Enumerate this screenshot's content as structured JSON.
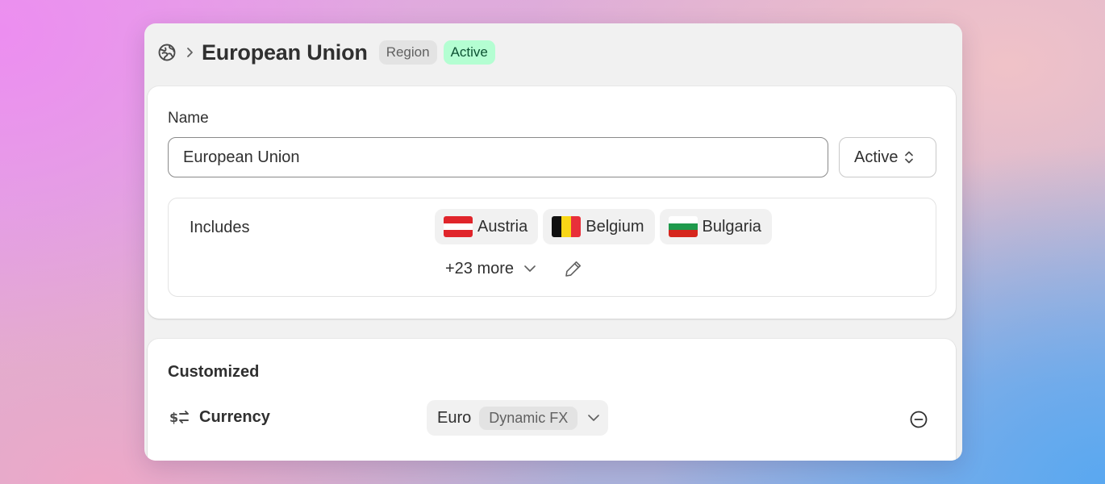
{
  "header": {
    "icon": "globe-icon",
    "title": "European Union",
    "type_badge": "Region",
    "status_badge": "Active"
  },
  "details": {
    "name_label": "Name",
    "name_value": "European Union",
    "status_value": "Active",
    "includes_label": "Includes",
    "countries": [
      {
        "name": "Austria",
        "flag": "austria-flag"
      },
      {
        "name": "Belgium",
        "flag": "belgium-flag"
      },
      {
        "name": "Bulgaria",
        "flag": "bulgaria-flag"
      }
    ],
    "more_label": "+23 more"
  },
  "customized": {
    "heading": "Customized",
    "currency_label": "Currency",
    "currency_value": "Euro",
    "fx_badge": "Dynamic FX"
  },
  "colors": {
    "active_badge_bg": "#b4fed2",
    "active_badge_text": "#0c5132",
    "neutral_badge_bg": "#e3e3e3",
    "text": "#303030"
  }
}
